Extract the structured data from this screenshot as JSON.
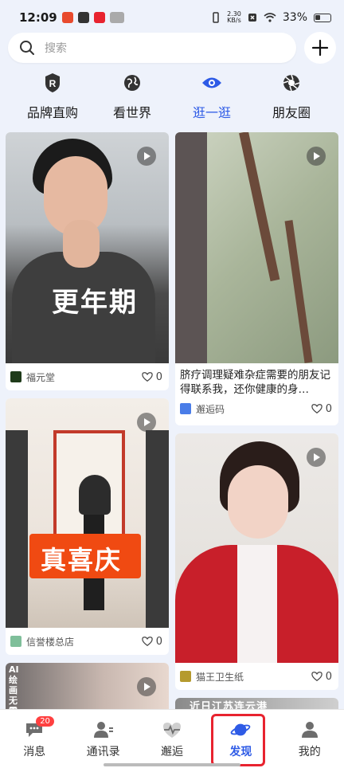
{
  "status_bar": {
    "time": "12:09",
    "speed_value": "2.30",
    "speed_unit": "KB/s",
    "battery": "33%"
  },
  "search": {
    "placeholder": "搜索"
  },
  "tabs": [
    {
      "label": "品牌直购",
      "icon": "brand-r-icon"
    },
    {
      "label": "看世界",
      "icon": "globe-icon"
    },
    {
      "label": "逛一逛",
      "icon": "eye-icon",
      "active": true
    },
    {
      "label": "朋友圈",
      "icon": "aperture-icon"
    }
  ],
  "feed": {
    "cards": [
      {
        "overlay": "更年期",
        "author": "福元堂",
        "likes": "0"
      },
      {
        "title": "脐疗调理疑难杂症需要的朋友记得联系我，还你健康的身…",
        "author": "邂逅码",
        "likes": "0"
      },
      {
        "overlay": "真喜庆",
        "author": "信誉楼总店",
        "likes": "0"
      },
      {
        "author": "猫王卫生纸",
        "likes": "0"
      },
      {
        "overlay": "AI绘画无需"
      },
      {
        "overlay": "近日江苏连云港"
      }
    ]
  },
  "bottom_nav": [
    {
      "label": "消息",
      "badge": "20"
    },
    {
      "label": "通讯录"
    },
    {
      "label": "邂逅"
    },
    {
      "label": "发现",
      "active": true
    },
    {
      "label": "我的"
    }
  ],
  "colors": {
    "accent": "#2e5be6",
    "highlight": "#e8232f",
    "badge": "#ff4040"
  }
}
